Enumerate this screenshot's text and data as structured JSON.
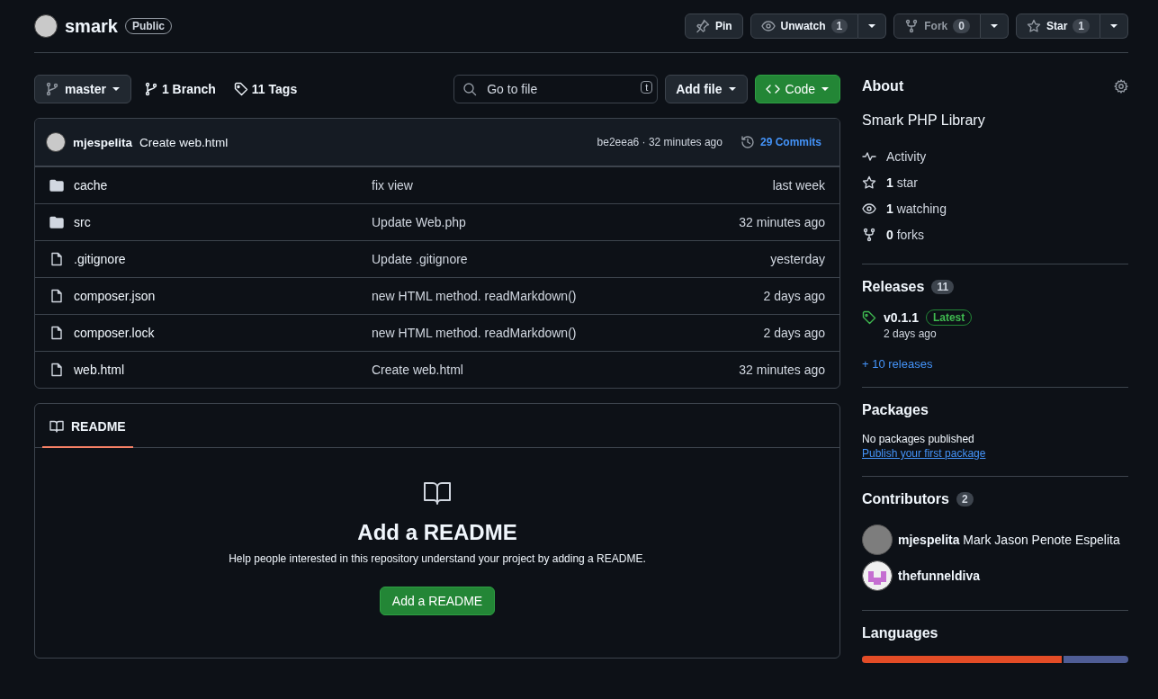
{
  "repo": {
    "name": "smark",
    "visibility": "Public"
  },
  "actions": [
    {
      "kind": "pin",
      "label": "Pin",
      "disabled": false
    },
    {
      "kind": "watch",
      "label": "Unwatch",
      "count": "1",
      "disabled": false
    },
    {
      "kind": "fork",
      "label": "Fork",
      "count": "0",
      "disabled": true
    },
    {
      "kind": "star",
      "label": "Star",
      "count": "1",
      "disabled": false
    }
  ],
  "toolbar": {
    "branch": "master",
    "branches": "1 Branch",
    "tags": "11 Tags",
    "search": {
      "placeholder": "Go to file",
      "shortcut": "t"
    },
    "add_file": "Add file",
    "code": "Code"
  },
  "latest_commit": {
    "author": "mjespelita",
    "message": "Create web.html",
    "meta": "be2eea6 · 32 minutes ago",
    "commits": "29 Commits"
  },
  "files": [
    {
      "kind": "folder",
      "name": "cache",
      "message": "fix view",
      "time": "last week"
    },
    {
      "kind": "folder",
      "name": "src",
      "message": "Update Web.php",
      "time": "32 minutes ago"
    },
    {
      "kind": "file",
      "name": ".gitignore",
      "message": "Update .gitignore",
      "time": "yesterday"
    },
    {
      "kind": "file",
      "name": "composer.json",
      "message": "new HTML method. readMarkdown()",
      "time": "2 days ago"
    },
    {
      "kind": "file",
      "name": "composer.lock",
      "message": "new HTML method. readMarkdown()",
      "time": "2 days ago"
    },
    {
      "kind": "file",
      "name": "web.html",
      "message": "Create web.html",
      "time": "32 minutes ago"
    }
  ],
  "readme": {
    "tab": "README",
    "title": "Add a README",
    "text": "Help people interested in this repository understand your project by adding a README.",
    "button": "Add a README"
  },
  "about": {
    "title": "About",
    "description": "Smark PHP Library",
    "stats": [
      {
        "kind": "activity",
        "label": "Activity"
      },
      {
        "kind": "star",
        "count": "1",
        "label": "star"
      },
      {
        "kind": "eye",
        "count": "1",
        "label": "watching"
      },
      {
        "kind": "fork",
        "count": "0",
        "label": "forks"
      }
    ]
  },
  "releases": {
    "title": "Releases",
    "count": "11",
    "latest": {
      "tag": "v0.1.1",
      "badge": "Latest",
      "time": "2 days ago"
    },
    "more": "+ 10 releases"
  },
  "packages": {
    "title": "Packages",
    "text": "No packages published",
    "link": "Publish your first package"
  },
  "contributors": {
    "title": "Contributors",
    "count": "2",
    "items": [
      {
        "kind": "photo",
        "login": "mjespelita",
        "name": "Mark Jason Penote Espelita"
      },
      {
        "kind": "identicon",
        "login": "thefunneldiva"
      }
    ]
  },
  "languages": {
    "title": "Languages",
    "segments": [
      {
        "color": "#e34c26",
        "level": 0.75
      },
      {
        "color": "#4f5d95"
      }
    ]
  }
}
